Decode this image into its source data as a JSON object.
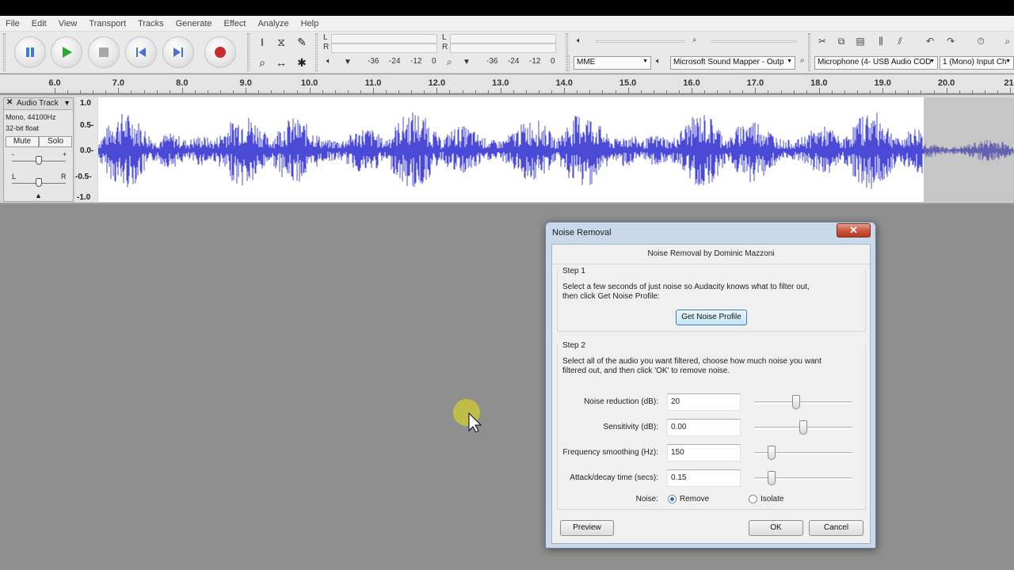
{
  "menu": [
    "File",
    "Edit",
    "View",
    "Transport",
    "Tracks",
    "Generate",
    "Effect",
    "Analyze",
    "Help"
  ],
  "transport": {
    "buttons": [
      {
        "name": "pause",
        "color": "#3d7bd9"
      },
      {
        "name": "play",
        "color": "#2ea82e"
      },
      {
        "name": "stop",
        "color": "#a8a8a8"
      },
      {
        "name": "skip-start",
        "color": "#4a6fd6"
      },
      {
        "name": "skip-end",
        "color": "#4a6fd6"
      },
      {
        "name": "record",
        "color": "#c72d2d"
      }
    ]
  },
  "meters": {
    "record_scale": [
      "-36",
      "-24",
      "-12",
      "0"
    ],
    "playback_scale": [
      "-36",
      "-24",
      "-12",
      "0"
    ],
    "channel_l": "L",
    "channel_r": "R"
  },
  "device": {
    "host": "MME",
    "output": "Microsoft Sound Mapper - Outp",
    "input": "Microphone (4- USB Audio COD",
    "channels": "1 (Mono) Input Ch"
  },
  "timeline": {
    "labels": [
      "6.0",
      "7.0",
      "8.0",
      "9.0",
      "10.0",
      "11.0",
      "12.0",
      "13.0",
      "14.0",
      "15.0",
      "16.0",
      "17.0",
      "18.0",
      "19.0",
      "20.0",
      "21."
    ]
  },
  "track": {
    "name": "Audio Track",
    "info1": "Mono, 44100Hz",
    "info2": "32-bit float",
    "mute": "Mute",
    "solo": "Solo",
    "gain_minus": "-",
    "gain_plus": "+",
    "pan_l": "L",
    "pan_r": "R",
    "vruler": [
      "1.0",
      "0.5-",
      "0.0-",
      "-0.5-",
      "-1.0"
    ],
    "wave_color": "#4a4ad6"
  },
  "dialog": {
    "title": "Noise Removal",
    "close": "✕",
    "header": "Noise Removal by Dominic Mazzoni",
    "step1_title": "Step 1",
    "step1_text_line1": "Select a few seconds of just noise so Audacity knows what to filter out,",
    "step1_text_line2": "then click Get Noise Profile:",
    "get_profile": "Get Noise Profile",
    "step2_title": "Step 2",
    "step2_text_line1": "Select all of the audio you want filtered, choose how much noise you want",
    "step2_text_line2": "filtered out, and then click 'OK' to remove noise.",
    "params": [
      {
        "label": "Noise reduction (dB):",
        "value": "20",
        "slider_level": 0.42
      },
      {
        "label": "Sensitivity (dB):",
        "value": "0.00",
        "slider_level": 0.5
      },
      {
        "label": "Frequency smoothing (Hz):",
        "value": "150",
        "slider_level": 0.15
      },
      {
        "label": "Attack/decay time (secs):",
        "value": "0.15",
        "slider_level": 0.15
      }
    ],
    "noise_label": "Noise:",
    "remove": "Remove",
    "isolate": "Isolate",
    "preview": "Preview",
    "ok": "OK",
    "cancel": "Cancel"
  }
}
